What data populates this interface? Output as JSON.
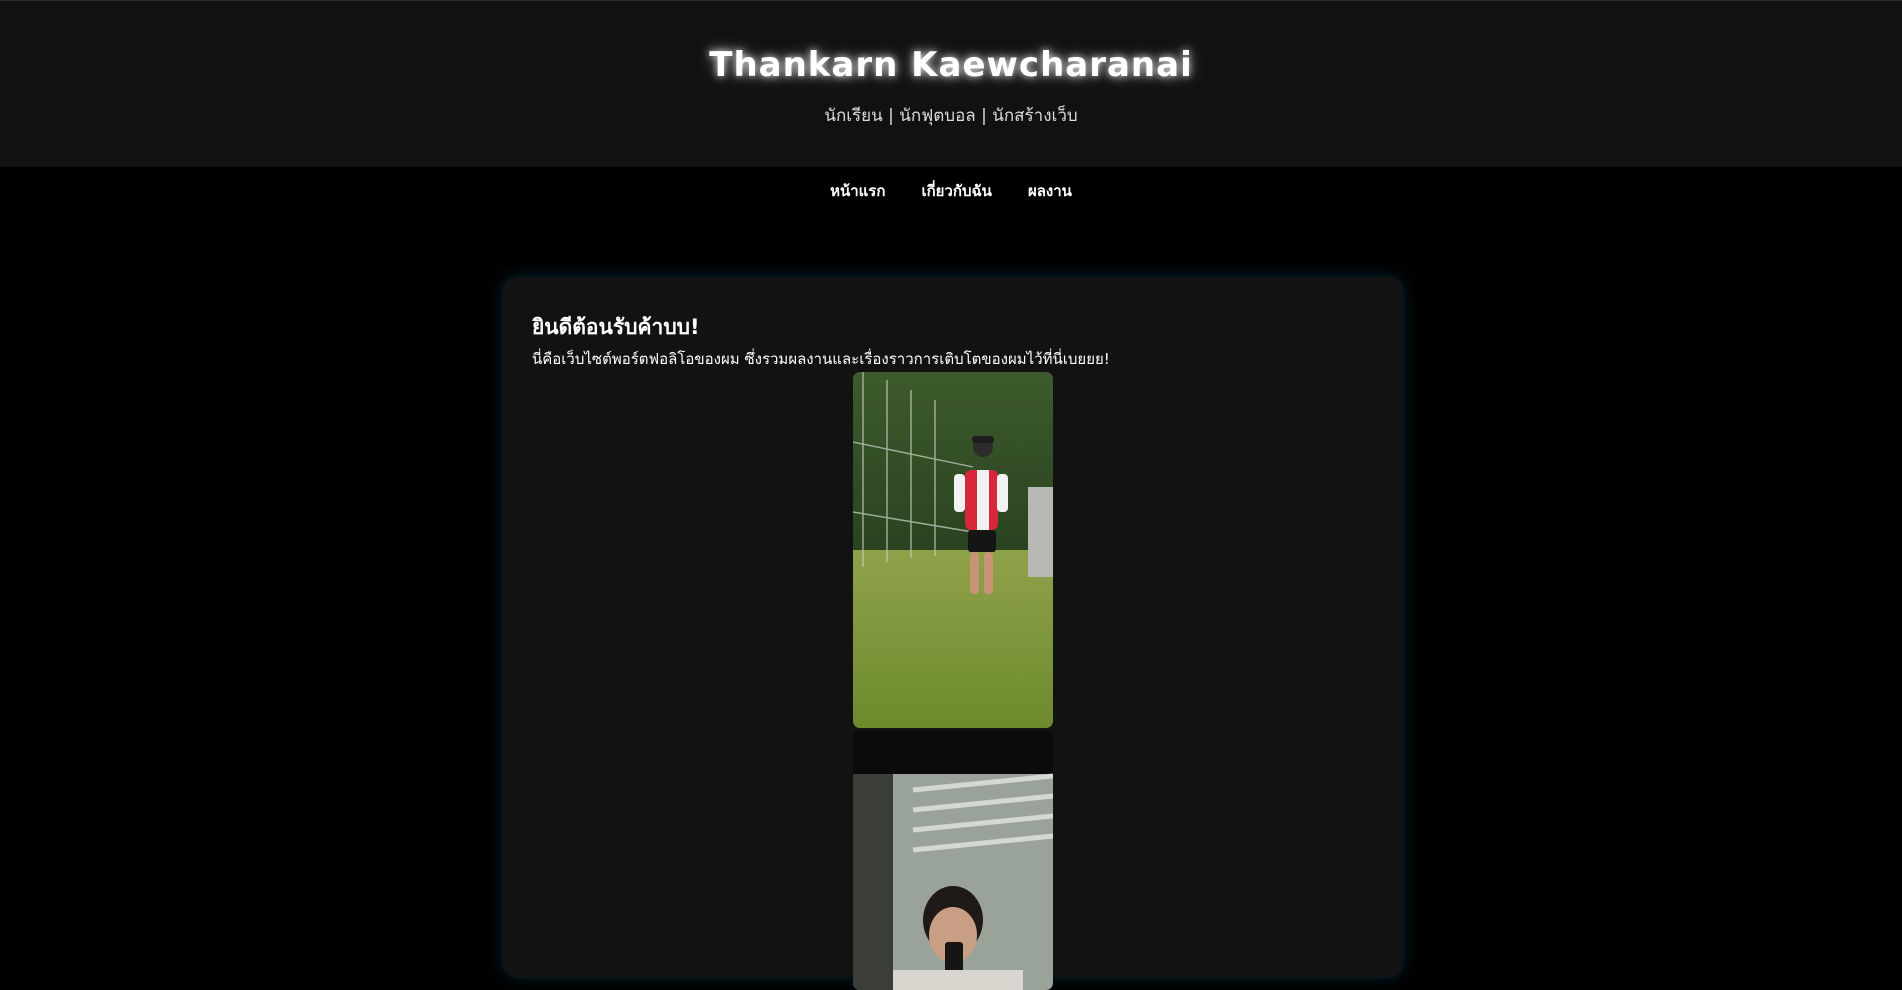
{
  "header": {
    "title": "Thankarn Kaewcharanai",
    "subtitle": "นักเรียน | นักฟุตบอล | นักสร้างเว็บ"
  },
  "nav": {
    "items": [
      {
        "label": "หน้าแรก"
      },
      {
        "label": "เกี่ยวกับฉัน"
      },
      {
        "label": "ผลงาน"
      }
    ]
  },
  "main": {
    "heading": "ยินดีต้อนรับค้าบบ!",
    "intro": "นี่คือเว็บไซต์พอร์ตฟอลิโอของผม ซึ่งรวมผลงานและเรื่องราวการเติบโตของผมไว้ที่นี่เบยยย!"
  },
  "colors": {
    "page_background": "#000000",
    "header_background": "#111111",
    "card_background": "#121212",
    "glow": "#00beff"
  }
}
